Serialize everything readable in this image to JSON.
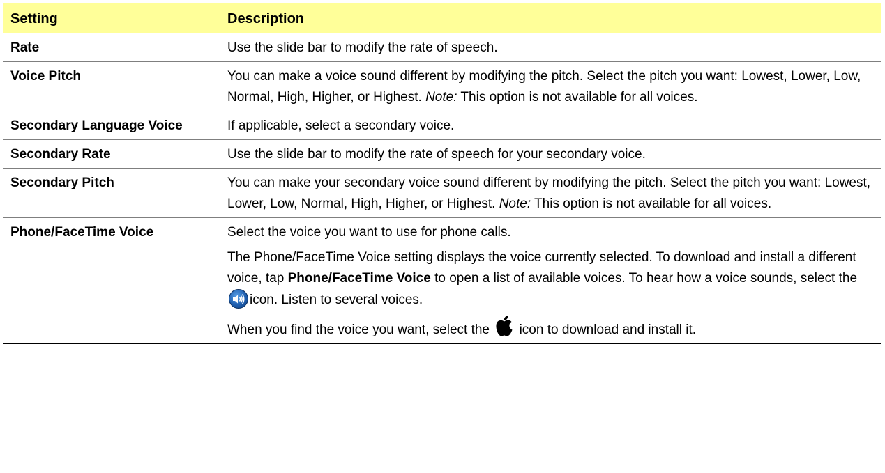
{
  "table": {
    "headers": {
      "setting": "Setting",
      "description": "Description"
    },
    "rows": [
      {
        "setting": "Rate",
        "description": "Use the slide bar to modify the rate of speech."
      },
      {
        "setting": "Voice Pitch",
        "description": "You can make a voice sound different by modifying the pitch. Select the pitch you want: Lowest, Lower, Low, Normal, High, Higher, or Highest.",
        "note_label": "Note:",
        "note_text": "This option is not available for all voices."
      },
      {
        "setting": "Secondary Language Voice",
        "description": "If applicable, select a secondary voice."
      },
      {
        "setting": "Secondary Rate",
        "description": "Use the slide bar to modify the rate of speech for your secondary voice."
      },
      {
        "setting": "Secondary Pitch",
        "description": "You can make your secondary voice sound different by modifying the pitch. Select the pitch you want: Lowest, Lower, Low, Normal, High, Higher, or Highest.",
        "note_label": "Note:",
        "note_text": "This option is not available for all voices."
      },
      {
        "setting": "Phone/FaceTime Voice",
        "para1": "Select the voice you want to use for phone calls.",
        "para2_a": "The Phone/FaceTime Voice setting displays the voice currently selected. To download and install a different voice, tap",
        "para2_bold": "Phone/FaceTime Voice",
        "para2_b": "to open a list of available voices. To hear how a voice sounds, select the",
        "para2_c": "icon. Listen to several voices.",
        "para3_a": "When you find the voice you want, select the",
        "para3_b": "icon to download and install it."
      }
    ]
  },
  "icons": {
    "speaker": "speaker-icon",
    "apple": "apple-icon"
  }
}
